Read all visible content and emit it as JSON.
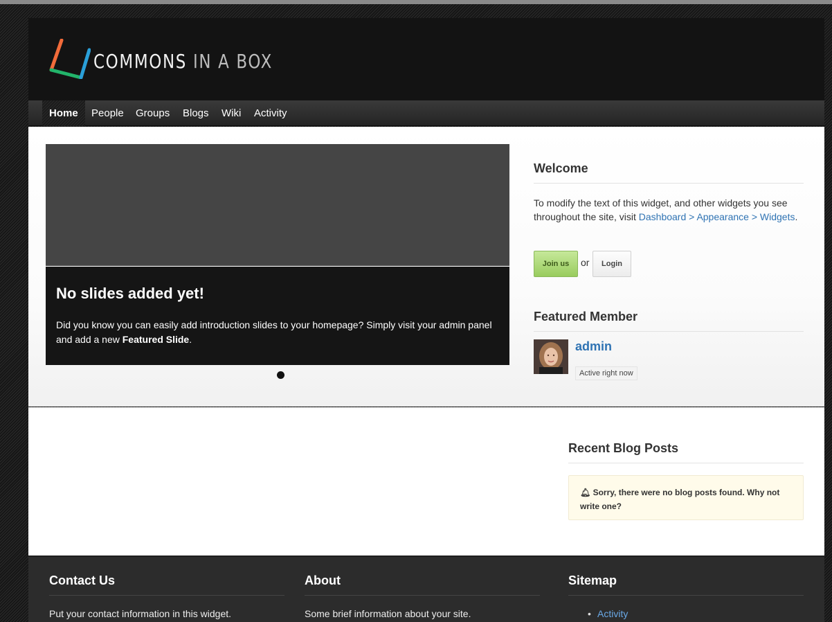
{
  "site": {
    "logo_word1": "COMMONS",
    "logo_word2": "IN A BOX"
  },
  "nav": {
    "items": [
      {
        "label": "Home",
        "active": true
      },
      {
        "label": "People"
      },
      {
        "label": "Groups"
      },
      {
        "label": "Blogs"
      },
      {
        "label": "Wiki"
      },
      {
        "label": "Activity"
      }
    ]
  },
  "slider": {
    "title": "No slides added yet!",
    "text_before": "Did you know you can easily add introduction slides to your homepage? Simply visit your admin panel and add a new ",
    "text_bold": "Featured Slide",
    "text_after": "."
  },
  "welcome": {
    "title": "Welcome",
    "text_before": "To modify the text of this widget, and other widgets you see throughout the site, visit ",
    "link": "Dashboard > Appearance > Widgets",
    "text_after": ".",
    "join_label": "Join us",
    "or_label": "or",
    "login_label": "Login"
  },
  "featured_member": {
    "title": "Featured Member",
    "name": "admin",
    "status": "Active right now"
  },
  "recent_posts": {
    "title": "Recent Blog Posts",
    "notice": "Sorry, there were no blog posts found. Why not write one?"
  },
  "footer": {
    "contact_title": "Contact Us",
    "contact_text": "Put your contact information in this widget.",
    "about_title": "About",
    "about_text": "Some brief information about your site.",
    "sitemap_title": "Sitemap",
    "sitemap_items": [
      "Activity"
    ]
  },
  "colors": {
    "link": "#2f73b3",
    "join_button": "#a8d86e",
    "logo_orange": "#f26b3a",
    "logo_green": "#22b46a",
    "logo_blue": "#2a9fd8"
  }
}
